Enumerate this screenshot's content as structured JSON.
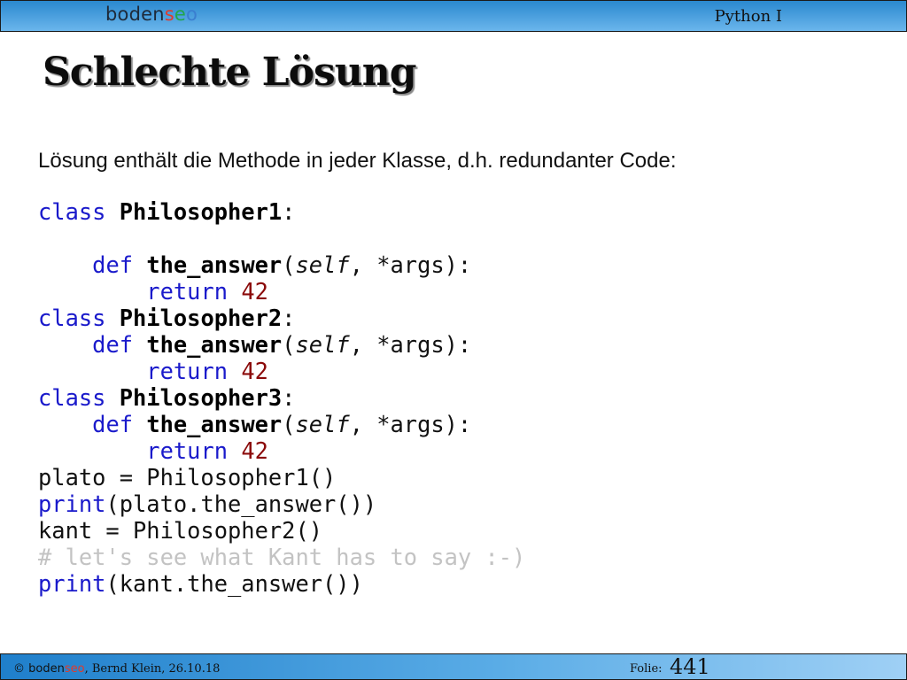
{
  "header": {
    "logo": {
      "part1": "boden",
      "part2": "s",
      "part3": "e",
      "part4": "o"
    },
    "course": "Python I"
  },
  "slide": {
    "title": "Schlechte Lösung",
    "intro": "Lösung enthält die Methode in jeder Klasse, d.h. redundanter Code:"
  },
  "code": {
    "kw_class": "class",
    "kw_def": "def",
    "kw_return": "return",
    "kw_print": "print",
    "class1": "Philosopher1",
    "class2": "Philosopher2",
    "class3": "Philosopher3",
    "method": "the_answer",
    "self": "self",
    "args": ", *args):",
    "value": "42",
    "plato_assign": "plato = Philosopher1()",
    "plato_print": "(plato.the_answer())",
    "kant_assign": "kant = Philosopher2()",
    "comment": "# let's see what Kant has to say :-)",
    "kant_print": "(kant.the_answer())"
  },
  "footer": {
    "copyright_symbol": "©",
    "brand_part1": "boden",
    "brand_part2": "seo",
    "author_date": ", Bernd Klein, 26.10.18",
    "folie_label": "Folie:",
    "page_number": "441"
  },
  "colors": {
    "header_bar": "#2a88cf",
    "keyword": "#1a1acb",
    "number": "#8b0a0a",
    "comment": "#c3c3c3"
  }
}
